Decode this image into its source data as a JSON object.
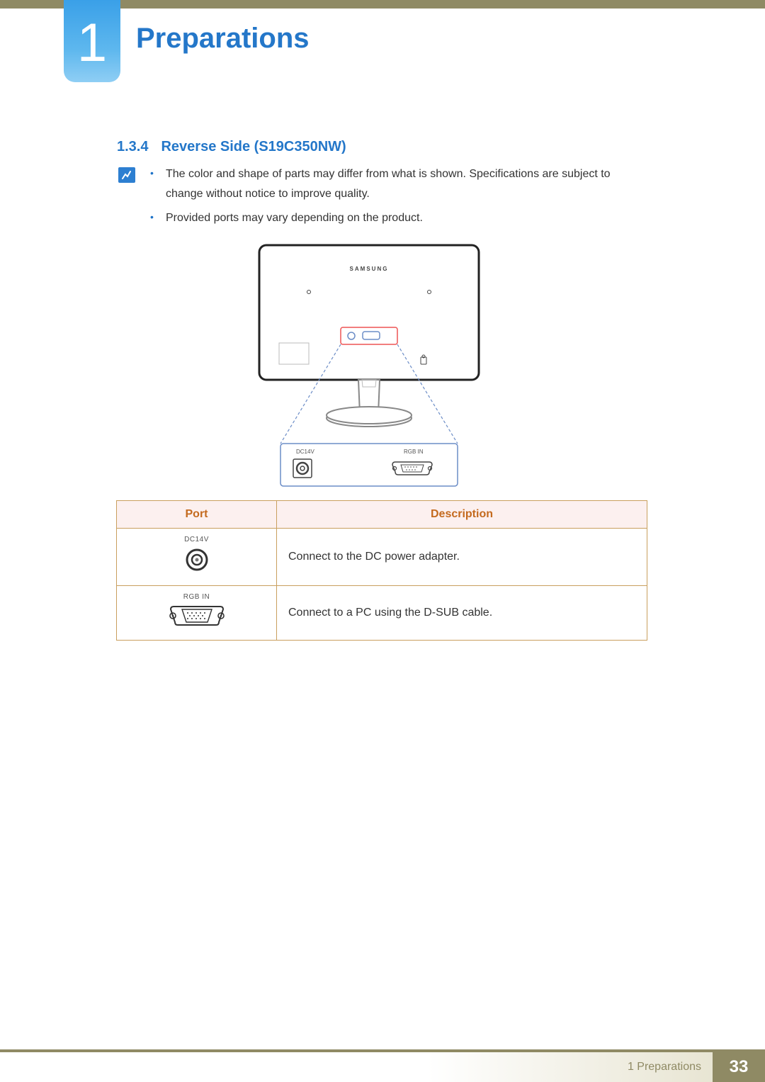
{
  "chapter": {
    "number": "1",
    "title": "Preparations"
  },
  "section": {
    "number": "1.3.4",
    "heading": "Reverse Side (S19C350NW)"
  },
  "notes": [
    "The color and shape of parts may differ from what is shown. Specifications are subject to change without notice to improve quality.",
    "Provided ports may vary depending on the product."
  ],
  "diagram": {
    "brand_label": "SAMSUNG",
    "callout_labels": {
      "dc": "DC14V",
      "rgb": "RGB IN"
    }
  },
  "table": {
    "headers": {
      "port": "Port",
      "description": "Description"
    },
    "rows": [
      {
        "port_label": "DC14V",
        "port_type": "dc-jack",
        "description": "Connect to the DC power adapter."
      },
      {
        "port_label": "RGB IN",
        "port_type": "dsub",
        "description": "Connect to a PC using the D-SUB cable."
      }
    ]
  },
  "footer": {
    "label": "1 Preparations",
    "page": "33"
  }
}
